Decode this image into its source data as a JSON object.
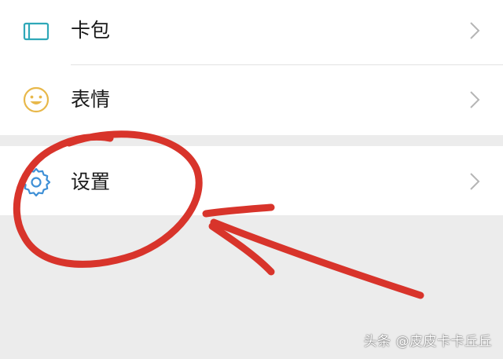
{
  "menu": {
    "items": [
      {
        "label": "卡包",
        "icon": "wallet-card-icon",
        "icon_color": "#2fa8b8"
      },
      {
        "label": "表情",
        "icon": "smiley-face-icon",
        "icon_color": "#e8b84a"
      },
      {
        "label": "设置",
        "icon": "gear-icon",
        "icon_color": "#3d8fd6"
      }
    ]
  },
  "annotation": {
    "color": "#d8342b",
    "shapes": [
      "hand-drawn-circle",
      "hand-drawn-arrow"
    ]
  },
  "watermark": {
    "text": "头条 @皮皮卡卡丘丘"
  }
}
